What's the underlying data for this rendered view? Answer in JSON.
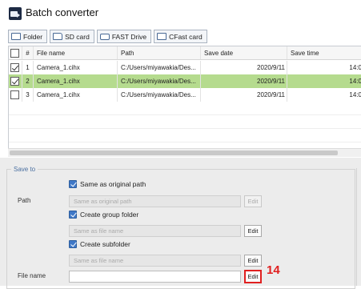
{
  "window": {
    "title": "Batch converter"
  },
  "toolbar": {
    "buttons": [
      {
        "label": "Folder",
        "icon": "folder-icon"
      },
      {
        "label": "SD card",
        "icon": "sd-card-icon"
      },
      {
        "label": "FAST Drive",
        "icon": "drive-icon"
      },
      {
        "label": "CFast card",
        "icon": "cfast-card-icon"
      }
    ]
  },
  "table": {
    "columns": [
      "",
      "#",
      "File name",
      "Path",
      "Save date",
      "Save time"
    ],
    "rows": [
      {
        "checked": true,
        "num": "1",
        "name": "Camera_1.cihx",
        "path": "C:/Users/miyawakia/Des...",
        "date": "2020/9/11",
        "time": "14:0",
        "selected": false
      },
      {
        "checked": true,
        "num": "2",
        "name": "Camera_1.cihx",
        "path": "C:/Users/miyawakia/Des...",
        "date": "2020/9/11",
        "time": "14:0",
        "selected": true
      },
      {
        "checked": false,
        "num": "3",
        "name": "Camera_1.cihx",
        "path": "C:/Users/miyawakia/Des...",
        "date": "2020/9/11",
        "time": "14:0",
        "selected": false
      }
    ]
  },
  "save_to": {
    "legend": "Save to",
    "path_label": "Path",
    "same_as_original_label": "Same as original path",
    "path_field_placeholder": "Same as original path",
    "create_group_folder_label": "Create group folder",
    "group_folder_placeholder": "Same as file name",
    "create_subfolder_label": "Create subfolder",
    "subfolder_placeholder": "Same as file name",
    "file_name_label": "File name",
    "file_name_value": "",
    "edit_label": "Edit"
  },
  "annotation": {
    "callout_number": "14",
    "color": "#e02020"
  },
  "colors": {
    "selected_row": "#b5db8e",
    "accent_checkbox": "#3f78c7"
  }
}
